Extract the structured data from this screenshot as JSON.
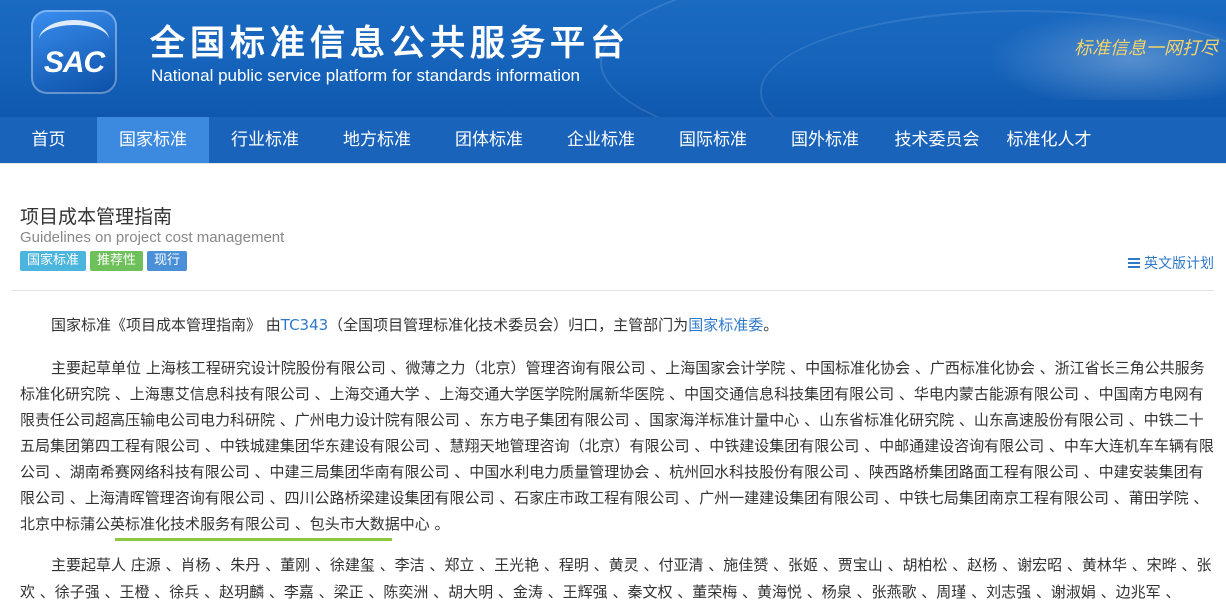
{
  "header": {
    "logo_text": "SAC",
    "title": "全国标准信息公共服务平台",
    "subtitle": "National public service platform  for standards information",
    "slogan": "标准信息一网打尽"
  },
  "nav": {
    "items": [
      "首页",
      "国家标准",
      "行业标准",
      "地方标准",
      "团体标准",
      "企业标准",
      "国际标准",
      "国外标准",
      "技术委员会",
      "标准化人才"
    ],
    "active_index": 1
  },
  "standard": {
    "title_zh": "项目成本管理指南",
    "title_en": "Guidelines on project cost management",
    "tags": [
      "国家标准",
      "推荐性",
      "现行"
    ],
    "english_plan_link": "英文版计划"
  },
  "intro": {
    "prefix": "国家标准《项目成本管理指南》 由",
    "tc_link": "TC343",
    "middle": "（全国项目管理标准化技术委员会）归口，主管部门为",
    "dept_link": "国家标准委",
    "suffix": "。"
  },
  "drafting_units": {
    "text": "主要起草单位 上海核工程研究设计院股份有限公司 、微薄之力（北京）管理咨询有限公司 、上海国家会计学院 、中国标准化协会 、广西标准化协会 、浙江省长三角公共服务标准化研究院 、上海惠艾信息科技有限公司 、上海交通大学 、上海交通大学医学院附属新华医院 、中国交通信息科技集团有限公司 、华电内蒙古能源有限公司 、中国南方电网有限责任公司超高压输电公司电力科研院 、广州电力设计院有限公司 、东方电子集团有限公司 、国家海洋标准计量中心 、山东省标准化研究院 、山东高速股份有限公司 、中铁二十五局集团第四工程有限公司 、中铁城建集团华东建设有限公司 、慧翔天地管理咨询（北京）有限公司 、中铁建设集团有限公司 、中邮通建设咨询有限公司 、中车大连机车车辆有限公司 、湖南希赛网络科技有限公司 、中建三局集团华南有限公司 、中国水利电力质量管理协会 、杭州回水科技股份有限公司 、陕西路桥集团路面工程有限公司 、中建安装集团有限公司 、上海清晖管理咨询有限公司 、四川公路桥梁建设集团有限公司 、石家庄市政工程有限公司 、广州一建建设集团有限公司 、中铁七局集团南京工程有限公司 、莆田学院 、北京中标蒲公英标准化技术服务有限公司 、包头市大数据中心 。"
  },
  "drafters": {
    "text": "主要起草人 庄源 、肖杨 、朱丹 、董刚 、徐建玺 、李洁 、郑立 、王光艳 、程明 、黄灵 、付亚清 、施佳赟 、张姬 、贾宝山 、胡柏松 、赵杨 、谢宏昭 、黄林华 、宋晔 、张欢 、徐子强 、王橙 、徐兵 、赵玥麟 、李嘉 、梁正 、陈奕洲 、胡大明 、金涛 、王辉强 、秦文权 、董荣梅 、黄海悦 、杨泉 、张燕歌 、周瑾 、刘志强 、谢淑娟 、边兆军 、"
  },
  "colors": {
    "header_blue": "#1563bb",
    "nav_blue": "#1a63ba",
    "nav_active": "#3c8ae0",
    "link_blue": "#2f79c8",
    "tag_national": "#4bb5dd",
    "tag_recommended": "#6ec05a",
    "tag_current": "#4a90d9",
    "highlight_green": "#8ec63f"
  }
}
